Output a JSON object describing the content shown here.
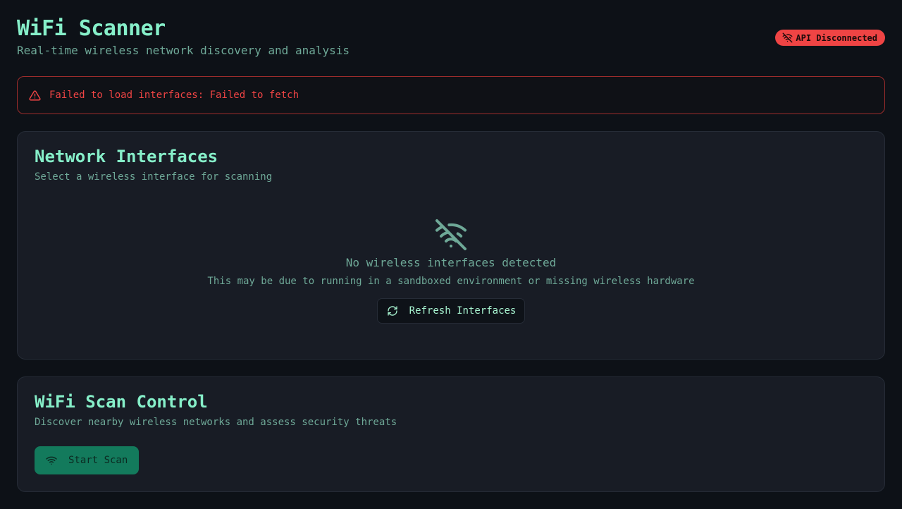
{
  "header": {
    "title": "WiFi Scanner",
    "subtitle": "Real-time wireless network discovery and analysis",
    "api_status": "API Disconnected",
    "api_status_color": "#ef4444"
  },
  "error": {
    "message": "Failed to load interfaces: Failed to fetch",
    "icon": "alert-triangle-icon"
  },
  "interfaces": {
    "title": "Network Interfaces",
    "description": "Select a wireless interface for scanning",
    "empty_title": "No wireless interfaces detected",
    "empty_description": "This may be due to running in a sandboxed environment or missing wireless hardware",
    "empty_icon": "wifi-off-icon",
    "refresh_label": "Refresh Interfaces",
    "refresh_icon": "refresh-icon"
  },
  "scan": {
    "title": "WiFi Scan Control",
    "description": "Discover nearby wireless networks and assess security threats",
    "start_label": "Start Scan",
    "start_icon": "wifi-icon"
  },
  "colors": {
    "accent": "#86efc9",
    "muted": "#6ea897",
    "error": "#ef4444",
    "primary_button": "#137a5c",
    "background": "#0d1117",
    "card": "#181c25"
  }
}
